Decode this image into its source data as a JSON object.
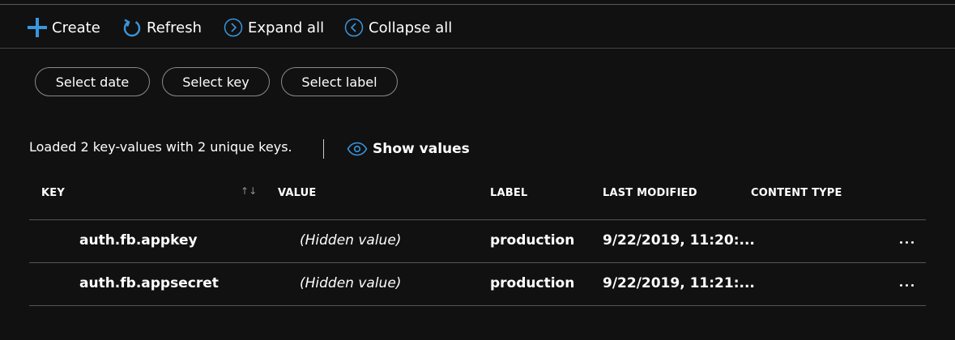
{
  "toolbar": {
    "create_label": "Create",
    "refresh_label": "Refresh",
    "expand_label": "Expand all",
    "collapse_label": "Collapse all",
    "icons": {
      "create": "plus-icon",
      "refresh": "refresh-icon",
      "expand": "chevron-right-circle-icon",
      "collapse": "chevron-left-circle-icon"
    }
  },
  "filters": {
    "date_label": "Select date",
    "key_label": "Select key",
    "label_label": "Select label"
  },
  "status": {
    "text": "Loaded 2 key-values with 2 unique keys.",
    "show_values_label": "Show values",
    "show_values_icon": "eye-icon"
  },
  "table": {
    "columns": {
      "key": "KEY",
      "sort_icon": "↑↓",
      "value": "VALUE",
      "label": "LABEL",
      "last_modified": "LAST MODIFIED",
      "content_type": "CONTENT TYPE"
    },
    "rows": [
      {
        "key": "auth.fb.appkey",
        "value": "(Hidden value)",
        "label": "production",
        "last_modified": "9/22/2019, 11:20:...",
        "content_type": ""
      },
      {
        "key": "auth.fb.appsecret",
        "value": "(Hidden value)",
        "label": "production",
        "last_modified": "9/22/2019, 11:21:...",
        "content_type": ""
      }
    ]
  },
  "colors": {
    "background": "#111111",
    "accent_blue": "#3a96dd",
    "text": "#ffffff",
    "divider": "#555555"
  }
}
